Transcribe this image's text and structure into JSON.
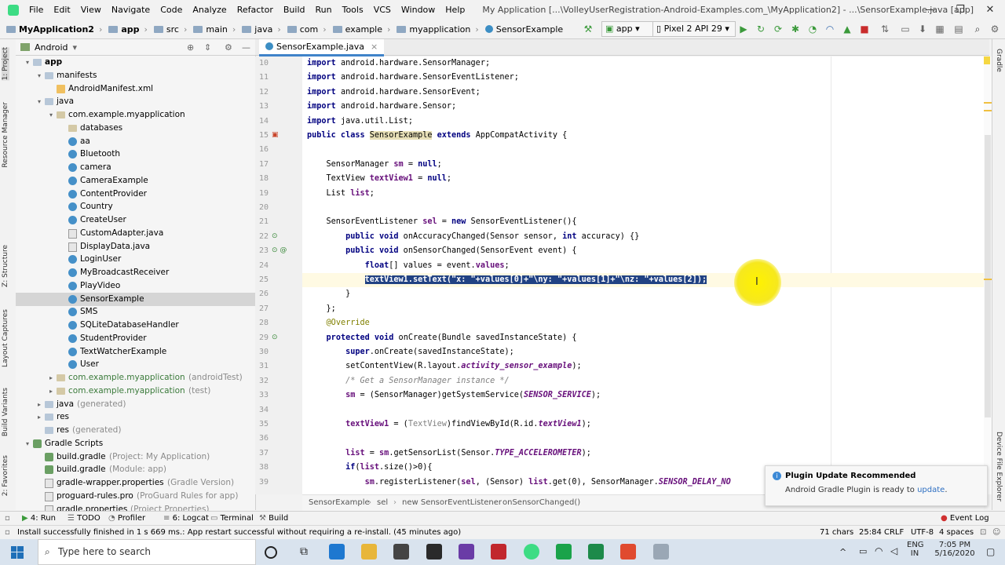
{
  "menubar": {
    "items": [
      "File",
      "Edit",
      "View",
      "Navigate",
      "Code",
      "Analyze",
      "Refactor",
      "Build",
      "Run",
      "Tools",
      "VCS",
      "Window",
      "Help"
    ],
    "window_title": "My Application [...\\VolleyUserRegistration-Android-Examples.com_\\MyApplication2] - ...\\SensorExample.java [app]",
    "minimize": "—",
    "maximize": "❐",
    "close": "✕"
  },
  "navbar": {
    "crumbs": [
      "MyApplication2",
      "app",
      "src",
      "main",
      "java",
      "com",
      "example",
      "myapplication",
      "SensorExample"
    ],
    "run_config": "app",
    "device": "Pixel 2 API 29"
  },
  "left_tabs": [
    "1: Project",
    "Resource Manager",
    "Z: Structure",
    "Layout Captures",
    "Build Variants",
    "2: Favorites"
  ],
  "right_tabs": [
    "Gradle",
    "Device File Explorer"
  ],
  "project_panel": {
    "view": "Android",
    "tree": [
      {
        "label": "app",
        "indent": 0,
        "icon": "folder",
        "tw": "▾",
        "bold": true
      },
      {
        "label": "manifests",
        "indent": 1,
        "icon": "folder",
        "tw": "▾"
      },
      {
        "label": "AndroidManifest.xml",
        "indent": 2,
        "icon": "xml",
        "tw": ""
      },
      {
        "label": "java",
        "indent": 1,
        "icon": "folder",
        "tw": "▾"
      },
      {
        "label": "com.example.myapplication",
        "indent": 2,
        "icon": "pkg",
        "tw": "▾"
      },
      {
        "label": "databases",
        "indent": 3,
        "icon": "pkg",
        "tw": ""
      },
      {
        "label": "aa",
        "indent": 3,
        "icon": "class",
        "tw": ""
      },
      {
        "label": "Bluetooth",
        "indent": 3,
        "icon": "class",
        "tw": ""
      },
      {
        "label": "camera",
        "indent": 3,
        "icon": "class",
        "tw": ""
      },
      {
        "label": "CameraExample",
        "indent": 3,
        "icon": "class",
        "tw": ""
      },
      {
        "label": "ContentProvider",
        "indent": 3,
        "icon": "class",
        "tw": ""
      },
      {
        "label": "Country",
        "indent": 3,
        "icon": "class",
        "tw": ""
      },
      {
        "label": "CreateUser",
        "indent": 3,
        "icon": "class",
        "tw": ""
      },
      {
        "label": "CustomAdapter.java",
        "indent": 3,
        "icon": "file",
        "tw": ""
      },
      {
        "label": "DisplayData.java",
        "indent": 3,
        "icon": "file",
        "tw": ""
      },
      {
        "label": "LoginUser",
        "indent": 3,
        "icon": "class",
        "tw": ""
      },
      {
        "label": "MyBroadcastReceiver",
        "indent": 3,
        "icon": "class",
        "tw": ""
      },
      {
        "label": "PlayVideo",
        "indent": 3,
        "icon": "class",
        "tw": ""
      },
      {
        "label": "SensorExample",
        "indent": 3,
        "icon": "class",
        "tw": "",
        "selected": true
      },
      {
        "label": "SMS",
        "indent": 3,
        "icon": "class",
        "tw": ""
      },
      {
        "label": "SQLiteDatabaseHandler",
        "indent": 3,
        "icon": "class",
        "tw": ""
      },
      {
        "label": "StudentProvider",
        "indent": 3,
        "icon": "class",
        "tw": ""
      },
      {
        "label": "TextWatcherExample",
        "indent": 3,
        "icon": "class",
        "tw": ""
      },
      {
        "label": "User",
        "indent": 3,
        "icon": "class",
        "tw": ""
      },
      {
        "label": "com.example.myapplication",
        "suffix": "(androidTest)",
        "indent": 2,
        "icon": "pkg",
        "tw": "▸",
        "style": "test"
      },
      {
        "label": "com.example.myapplication",
        "suffix": "(test)",
        "indent": 2,
        "icon": "pkg",
        "tw": "▸",
        "style": "test"
      },
      {
        "label": "java",
        "suffix": "(generated)",
        "indent": 1,
        "icon": "folder",
        "tw": "▸"
      },
      {
        "label": "res",
        "indent": 1,
        "icon": "folder",
        "tw": "▸"
      },
      {
        "label": "res",
        "suffix": "(generated)",
        "indent": 1,
        "icon": "folder",
        "tw": ""
      },
      {
        "label": "Gradle Scripts",
        "indent": 0,
        "icon": "gradle",
        "tw": "▾"
      },
      {
        "label": "build.gradle",
        "suffix": "(Project: My Application)",
        "indent": 1,
        "icon": "gradle",
        "tw": ""
      },
      {
        "label": "build.gradle",
        "suffix": "(Module: app)",
        "indent": 1,
        "icon": "gradle",
        "tw": ""
      },
      {
        "label": "gradle-wrapper.properties",
        "suffix": "(Gradle Version)",
        "indent": 1,
        "icon": "file",
        "tw": ""
      },
      {
        "label": "proguard-rules.pro",
        "suffix": "(ProGuard Rules for app)",
        "indent": 1,
        "icon": "file",
        "tw": ""
      },
      {
        "label": "gradle.properties",
        "suffix": "(Project Properties)",
        "indent": 1,
        "icon": "file",
        "tw": ""
      }
    ]
  },
  "editor": {
    "tab": "SensorExample.java",
    "lines": [
      {
        "n": "10",
        "html": "<span class='kw'>import</span> android.hardware.SensorManager;"
      },
      {
        "n": "11",
        "html": "<span class='kw'>import</span> android.hardware.SensorEventListener;"
      },
      {
        "n": "12",
        "html": "<span class='kw'>import</span> android.hardware.SensorEvent;"
      },
      {
        "n": "13",
        "html": "<span class='kw'>import</span> android.hardware.Sensor;"
      },
      {
        "n": "14",
        "html": "<span class='kw'>import</span> java.util.List;"
      },
      {
        "n": "15",
        "html": "<span class='kw'>public class</span> <span class='hl-ident'>SensorExample</span> <span class='kw'>extends</span> AppCompatActivity {"
      },
      {
        "n": "16",
        "html": ""
      },
      {
        "n": "17",
        "html": "    SensorManager <span class='fld'>sm</span> = <span class='kw'>null</span>;"
      },
      {
        "n": "18",
        "html": "    TextView <span class='fld'>textView1</span> = <span class='kw'>null</span>;"
      },
      {
        "n": "19",
        "html": "    List <span class='fld'>list</span>;"
      },
      {
        "n": "20",
        "html": ""
      },
      {
        "n": "21",
        "html": "    SensorEventListener <span class='fld'>sel</span> = <span class='kw'>new</span> SensorEventListener(){"
      },
      {
        "n": "22",
        "html": "        <span class='kw'>public void</span> onAccuracyChanged(Sensor sensor, <span class='kw'>int</span> accuracy) {}"
      },
      {
        "n": "23",
        "html": "        <span class='kw'>public void</span> onSensorChanged(SensorEvent event) {"
      },
      {
        "n": "24",
        "html": "            <span class='kw'>float</span>[] values = event.<span class='fld'>values</span>;"
      },
      {
        "n": "25",
        "html": "            <span class='sel-text'>textView1.setText(\"x: \"+values[0]+\"\\ny: \"+values[1]+\"\\nz: \"+values[2]);</span>"
      },
      {
        "n": "26",
        "html": "        }"
      },
      {
        "n": "27",
        "html": "    };"
      },
      {
        "n": "28",
        "html": "    <span class='an'>@Override</span>"
      },
      {
        "n": "29",
        "html": "    <span class='kw'>protected void</span> onCreate(Bundle savedInstanceState) {"
      },
      {
        "n": "30",
        "html": "        <span class='kw'>super</span>.onCreate(savedInstanceState);"
      },
      {
        "n": "31",
        "html": "        setContentView(R.layout.<span class='fld it'>activity_sensor_example</span>);"
      },
      {
        "n": "32",
        "html": "        <span class='cm'>/* Get a SensorManager instance */</span>"
      },
      {
        "n": "33",
        "html": "        <span class='fld'>sm</span> = (SensorManager)getSystemService(<span class='fld it'>SENSOR_SERVICE</span>);"
      },
      {
        "n": "34",
        "html": ""
      },
      {
        "n": "35",
        "html": "        <span class='fld'>textView1</span> = (<span class='gr'>TextView</span>)findViewById(R.id.<span class='fld it'>textView1</span>);"
      },
      {
        "n": "36",
        "html": ""
      },
      {
        "n": "37",
        "html": "        <span class='fld'>list</span> = <span class='fld'>sm</span>.getSensorList(Sensor.<span class='fld it'>TYPE_ACCELEROMETER</span>);"
      },
      {
        "n": "38",
        "html": "        <span class='kw'>if</span>(<span class='fld'>list</span>.size()>0){"
      },
      {
        "n": "39",
        "html": "            <span class='fld'>sm</span>.registerListener(<span class='fld'>sel</span>, (Sensor) <span class='fld'>list</span>.get(0), SensorManager.<span class='fld it'>SENSOR_DELAY_NO</span>"
      }
    ],
    "breadcrumbs": [
      "SensorExample",
      "sel",
      "new SensorEventListener",
      "onSensorChanged()"
    ]
  },
  "notification": {
    "title": "Plugin Update Recommended",
    "body": "Android Gradle Plugin is ready to",
    "link": "update"
  },
  "bottom_tools": [
    "4: Run",
    "TODO",
    "Profiler",
    "6: Logcat",
    "Terminal",
    "Build"
  ],
  "event_log": "Event Log",
  "status": {
    "message": "Install successfully finished in 1 s 669 ms.: App restart successful without requiring a re-install. (45 minutes ago)",
    "chars": "71 chars",
    "position": "25:84",
    "line_sep": "CRLF",
    "encoding": "UTF-8",
    "indent": "4 spaces"
  },
  "taskbar": {
    "search_placeholder": "Type here to search",
    "lang": "ENG",
    "region": "IN",
    "time": "7:05 PM",
    "date": "5/16/2020"
  },
  "colors": {
    "accent": "#4083c9",
    "selection": "#214283",
    "android_green": "#3ddc84"
  }
}
